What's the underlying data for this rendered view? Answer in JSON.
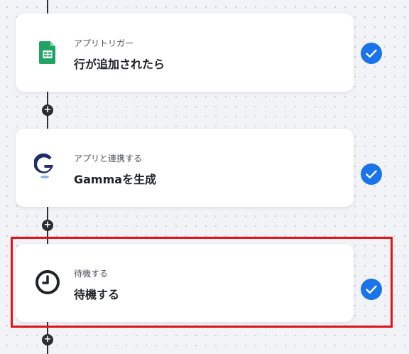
{
  "flow": {
    "steps": [
      {
        "caption": "アプリトリガー",
        "title": "行が追加されたら",
        "icon": "google-sheets-icon",
        "status": "completed"
      },
      {
        "caption": "アプリと連携する",
        "title": "Gammaを生成",
        "icon": "gamma-icon",
        "status": "completed"
      },
      {
        "caption": "待機する",
        "title": "待機する",
        "icon": "clock-icon",
        "status": "completed",
        "highlighted": true
      }
    ],
    "add_step_symbol": "+"
  },
  "colors": {
    "check_blue": "#1a73e8",
    "highlight_red": "#e0141b",
    "sheets_green": "#20a464",
    "gamma_navy": "#1b2f6b",
    "connector": "#2b2d33"
  }
}
